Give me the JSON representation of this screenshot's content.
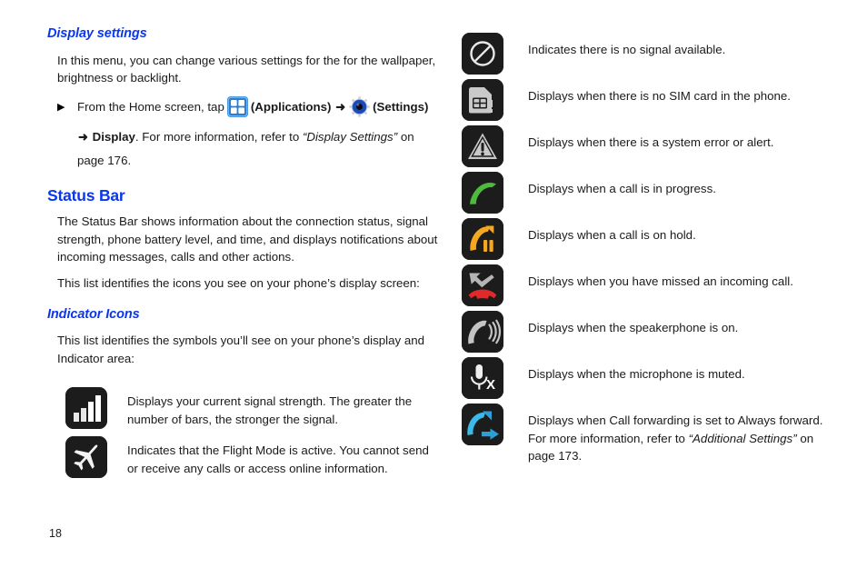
{
  "document": {
    "page_number": "18"
  },
  "display_settings": {
    "heading": "Display settings",
    "intro": "In this menu, you can change various settings for the for the wallpaper, brightness or backlight.",
    "bullet": {
      "marker": "▶",
      "lead": "From the Home screen, tap",
      "applications_label": "(Applications)",
      "arrow1": "➜",
      "arrow2": "➜",
      "settings_label": "(Settings)",
      "display_label": "Display",
      "sentence_tail": ". For more information, refer to",
      "reference_title": "“Display Settings”",
      "reference_page": " on page 176.",
      "applications_icon": "applications-grid-icon",
      "settings_icon": "settings-gear-icon"
    }
  },
  "status_bar": {
    "heading": "Status Bar",
    "paragraph1": "The Status Bar shows information about the connection status, signal strength, phone battery level, and time, and displays notifications about incoming messages, calls and other actions.",
    "paragraph2": "This list identifies the icons you see on your phone’s display screen:"
  },
  "indicator_icons": {
    "heading": "Indicator Icons",
    "intro": "This list identifies the symbols you’ll see on your phone’s display and Indicator area:",
    "left_column": [
      {
        "icon": "signal-strength-icon",
        "description": "Displays your current signal strength. The greater the number of bars, the stronger the signal."
      },
      {
        "icon": "flight-mode-airplane-icon",
        "description": "Indicates that the Flight Mode is active. You cannot send or receive any calls or access online information."
      }
    ],
    "right_column": [
      {
        "icon": "no-signal-icon",
        "description": "Indicates there is no signal available."
      },
      {
        "icon": "no-sim-card-icon",
        "description": "Displays when there is no SIM card in the phone."
      },
      {
        "icon": "system-error-alert-icon",
        "description": "Displays when there is a system error or alert."
      },
      {
        "icon": "call-in-progress-icon",
        "description": "Displays when a call is in progress."
      },
      {
        "icon": "call-on-hold-icon",
        "description": "Displays when a call is on hold."
      },
      {
        "icon": "missed-call-icon",
        "description": "Displays when you have missed an incoming call."
      },
      {
        "icon": "speakerphone-on-icon",
        "description": "Displays when the speakerphone is on."
      },
      {
        "icon": "microphone-muted-icon",
        "description": "Displays when the microphone is muted."
      },
      {
        "icon": "call-forwarding-icon",
        "description_line1": "Displays when Call forwarding is set to Always forward.",
        "description_line2_pre": "For more information, refer to",
        "description_line2_title": "“Additional Settings”",
        "description_line2_post": " on",
        "description_line3": "page 173."
      }
    ]
  },
  "colors": {
    "heading_blue": "#0a37ee",
    "badge_dark": "#1c1c1c",
    "call_green": "#4cbb3c",
    "hold_orange": "#f5a720",
    "missed_red": "#e3282a",
    "forward_cyan": "#3bb9e8",
    "app_icon_blue": "#2a7fd4"
  }
}
